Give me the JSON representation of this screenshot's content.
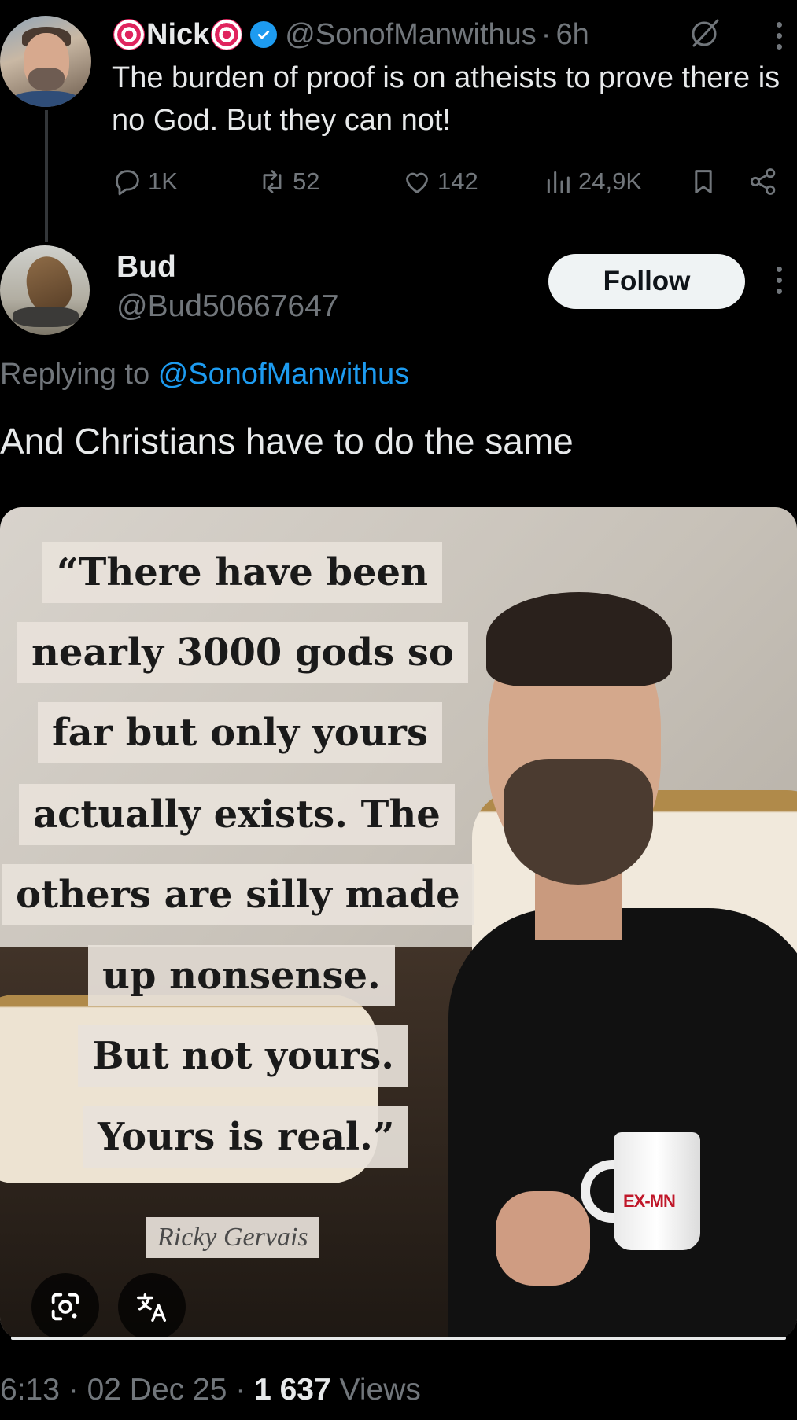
{
  "parent": {
    "display_name": "Nick",
    "handle": "@SonofManwithus",
    "separator": "·",
    "time": "6h",
    "text": "The burden of proof is on atheists to prove there is no God. But they can not!",
    "stats": {
      "replies": "1K",
      "reposts": "52",
      "likes": "142",
      "views": "24,9K"
    }
  },
  "reply": {
    "display_name": "Bud",
    "handle": "@Bud50667647",
    "follow_label": "Follow",
    "replying_prefix": "Replying to",
    "replying_mention": "@SonofManwithus",
    "text": "And Christians have to do the same"
  },
  "media": {
    "quote_lines": [
      "“There have been",
      "nearly 3000 gods so",
      "far but only yours",
      "actually exists. The",
      "others are silly made",
      "up nonsense.",
      "But not yours.",
      "Yours is real.”"
    ],
    "attribution": "Ricky Gervais",
    "mug_logo": "EX-MN"
  },
  "footer": {
    "time": "6:13",
    "sep1": "·",
    "date": "02 Dec 25",
    "sep2": "·",
    "views_count": "1 637",
    "views_label": "Views"
  },
  "icons": {
    "reply": "comment-bubble-icon",
    "repost": "repost-arrows-icon",
    "like": "heart-icon",
    "views": "bar-chart-icon",
    "bookmark": "bookmark-icon",
    "share": "share-icon",
    "grok": "grok-slash-circle-icon",
    "more": "vertical-ellipsis-icon",
    "lens": "google-lens-icon",
    "translate": "translate-icon"
  },
  "colors": {
    "background": "#000000",
    "text": "#e7e9ea",
    "muted": "#71767b",
    "accent": "#1d9bf0",
    "follow_bg": "#eff3f4"
  }
}
